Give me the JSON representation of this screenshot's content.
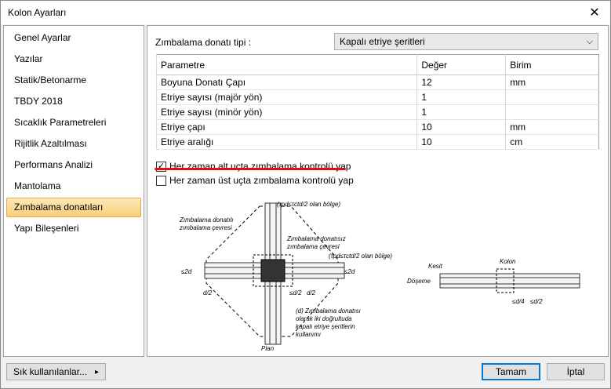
{
  "window": {
    "title": "Kolon Ayarları"
  },
  "sidebar": {
    "items": [
      {
        "label": "Genel Ayarlar"
      },
      {
        "label": "Yazılar"
      },
      {
        "label": "Statik/Betonarme"
      },
      {
        "label": "TBDY 2018"
      },
      {
        "label": "Sıcaklık Parametreleri"
      },
      {
        "label": "Rijitlik Azaltılması"
      },
      {
        "label": "Performans Analizi"
      },
      {
        "label": "Mantolama"
      },
      {
        "label": "Zımbalama donatıları"
      },
      {
        "label": "Yapı Bileşenleri"
      }
    ],
    "active_index": 8
  },
  "form": {
    "type_label": "Zımbalama donatı tipi :",
    "type_value": "Kapalı etriye şeritleri"
  },
  "table": {
    "headers": [
      "Parametre",
      "Değer",
      "Birim"
    ],
    "rows": [
      [
        "Boyuna Donatı Çapı",
        "12",
        "mm"
      ],
      [
        "Etriye sayısı (majör yön)",
        "1",
        ""
      ],
      [
        "Etriye sayısı (minör yön)",
        "1",
        ""
      ],
      [
        "Etriye çapı",
        "10",
        "mm"
      ],
      [
        "Etriye aralığı",
        "10",
        "cm"
      ]
    ]
  },
  "checks": {
    "alt": {
      "label": "Her zaman alt uçta zımbalama kontrolü yap",
      "checked": true,
      "check_glyph": "✓"
    },
    "ust": {
      "label": "Her zaman üst uçta zımbalama kontrolü yap",
      "checked": false
    }
  },
  "diagram": {
    "label_top": "(τpd≤τctd/2 olan bölge)",
    "label_right": "(τpd≤τctd/2 olan bölge)",
    "label_outer_1": "Zımbalama donatılı",
    "label_outer_2": "zımbalama çevresi",
    "label_inner_1": "Zımbalama donatısız",
    "label_inner_2": "zımbalama çevresi",
    "dim_2d_left": "≤2d",
    "dim_2d_right": "≤2d",
    "dim_d2_1": "d/2",
    "dim_d2_2": "≤d/2",
    "dim_d2_3": "d/2",
    "note_1": "(d) Zımbalama donatısı",
    "note_2": "olarak iki doğrultuda",
    "note_3": "kapalı etriye şeritlerin",
    "note_4": "kullanımı",
    "plan": "Plan",
    "kesit": "Kesit",
    "kolon": "Kolon",
    "doseme": "Döşeme",
    "dim_d4": "≤d/4",
    "dim_d2_section": "≤d/2"
  },
  "footer": {
    "freq_button": "Sık kullanılanlar...",
    "freq_arrow": "▸",
    "ok_button": "Tamam",
    "cancel_button": "İptal"
  },
  "colors": {
    "highlight": "#f8cf7b",
    "underline": "#e01010",
    "primary_border": "#0078d7"
  }
}
